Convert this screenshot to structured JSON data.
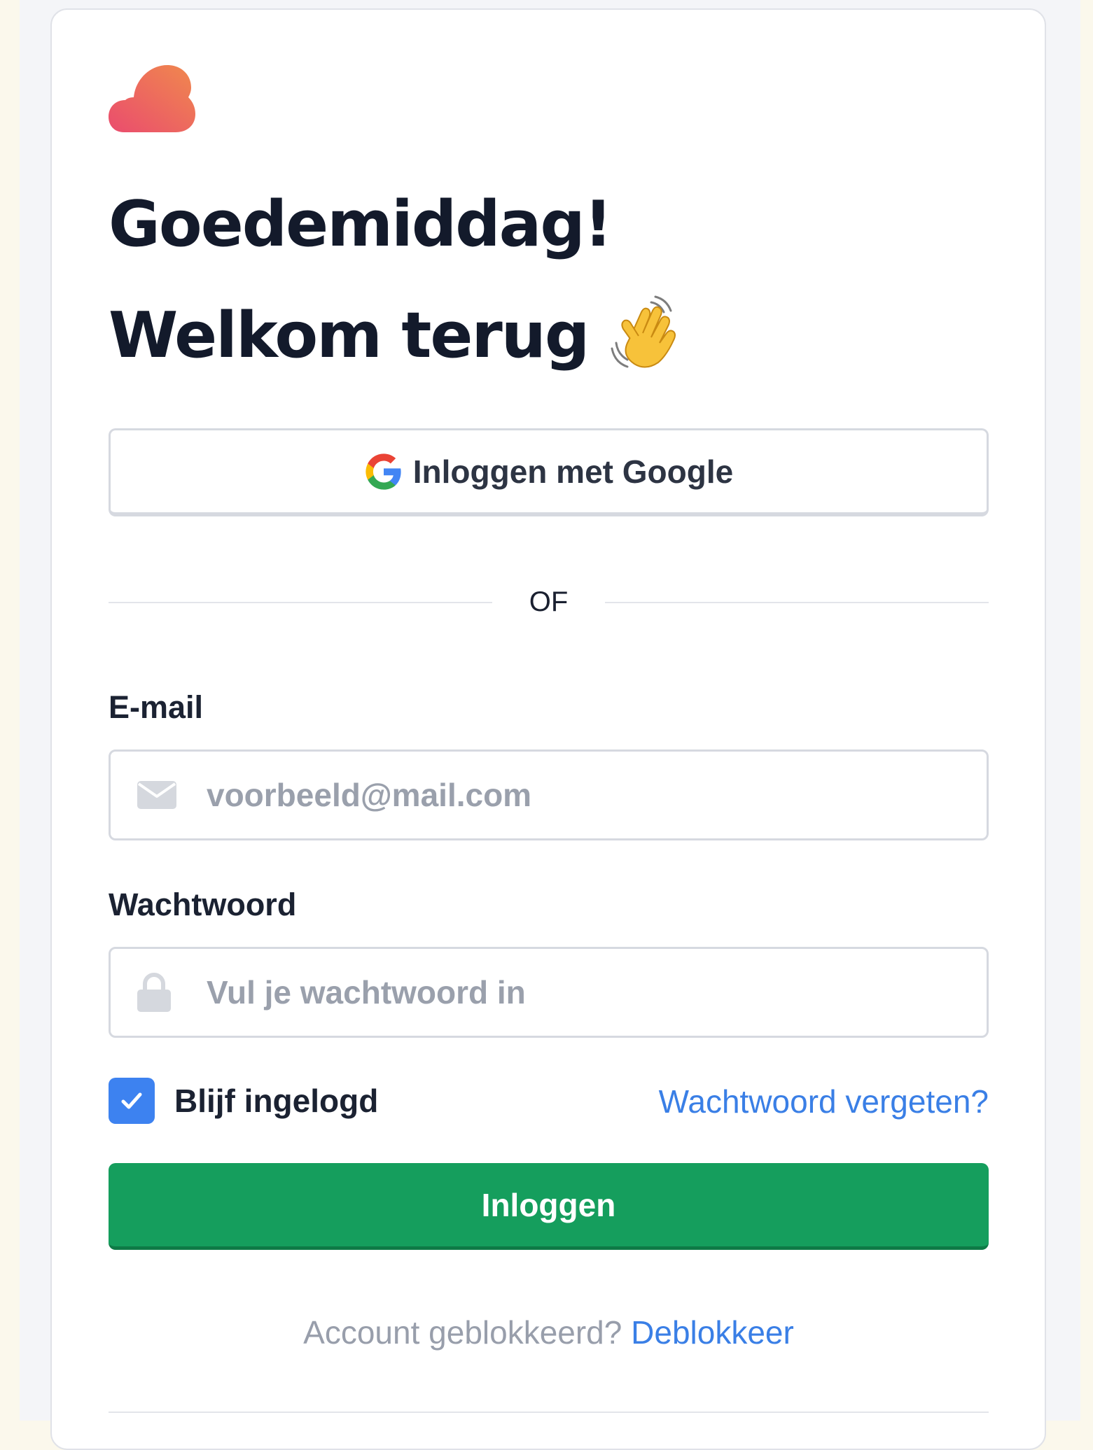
{
  "greeting": {
    "line1": "Goedemiddag!",
    "line2": "Welkom terug"
  },
  "google_button": {
    "label": "Inloggen met Google"
  },
  "divider": {
    "label": "OF"
  },
  "email": {
    "label": "E-mail",
    "placeholder": "voorbeeld@mail.com",
    "value": ""
  },
  "password": {
    "label": "Wachtwoord",
    "placeholder": "Vul je wachtwoord in",
    "value": ""
  },
  "remember": {
    "label": "Blijf ingelogd",
    "checked": true
  },
  "forgot": {
    "label": "Wachtwoord vergeten?"
  },
  "login_button": {
    "label": "Inloggen"
  },
  "footer": {
    "text": "Account geblokkeerd?",
    "link": "Deblokkeer"
  },
  "icons": {
    "logo": "cloud-logo",
    "wave": "waving-hand-icon",
    "google": "google-icon",
    "email": "envelope-icon",
    "password": "lock-icon",
    "checkbox": "checkmark-icon"
  },
  "colors": {
    "primary_button": "#159e5d",
    "link": "#3a7fe6",
    "checkbox": "#3d82f0",
    "heading": "#131a2b"
  }
}
